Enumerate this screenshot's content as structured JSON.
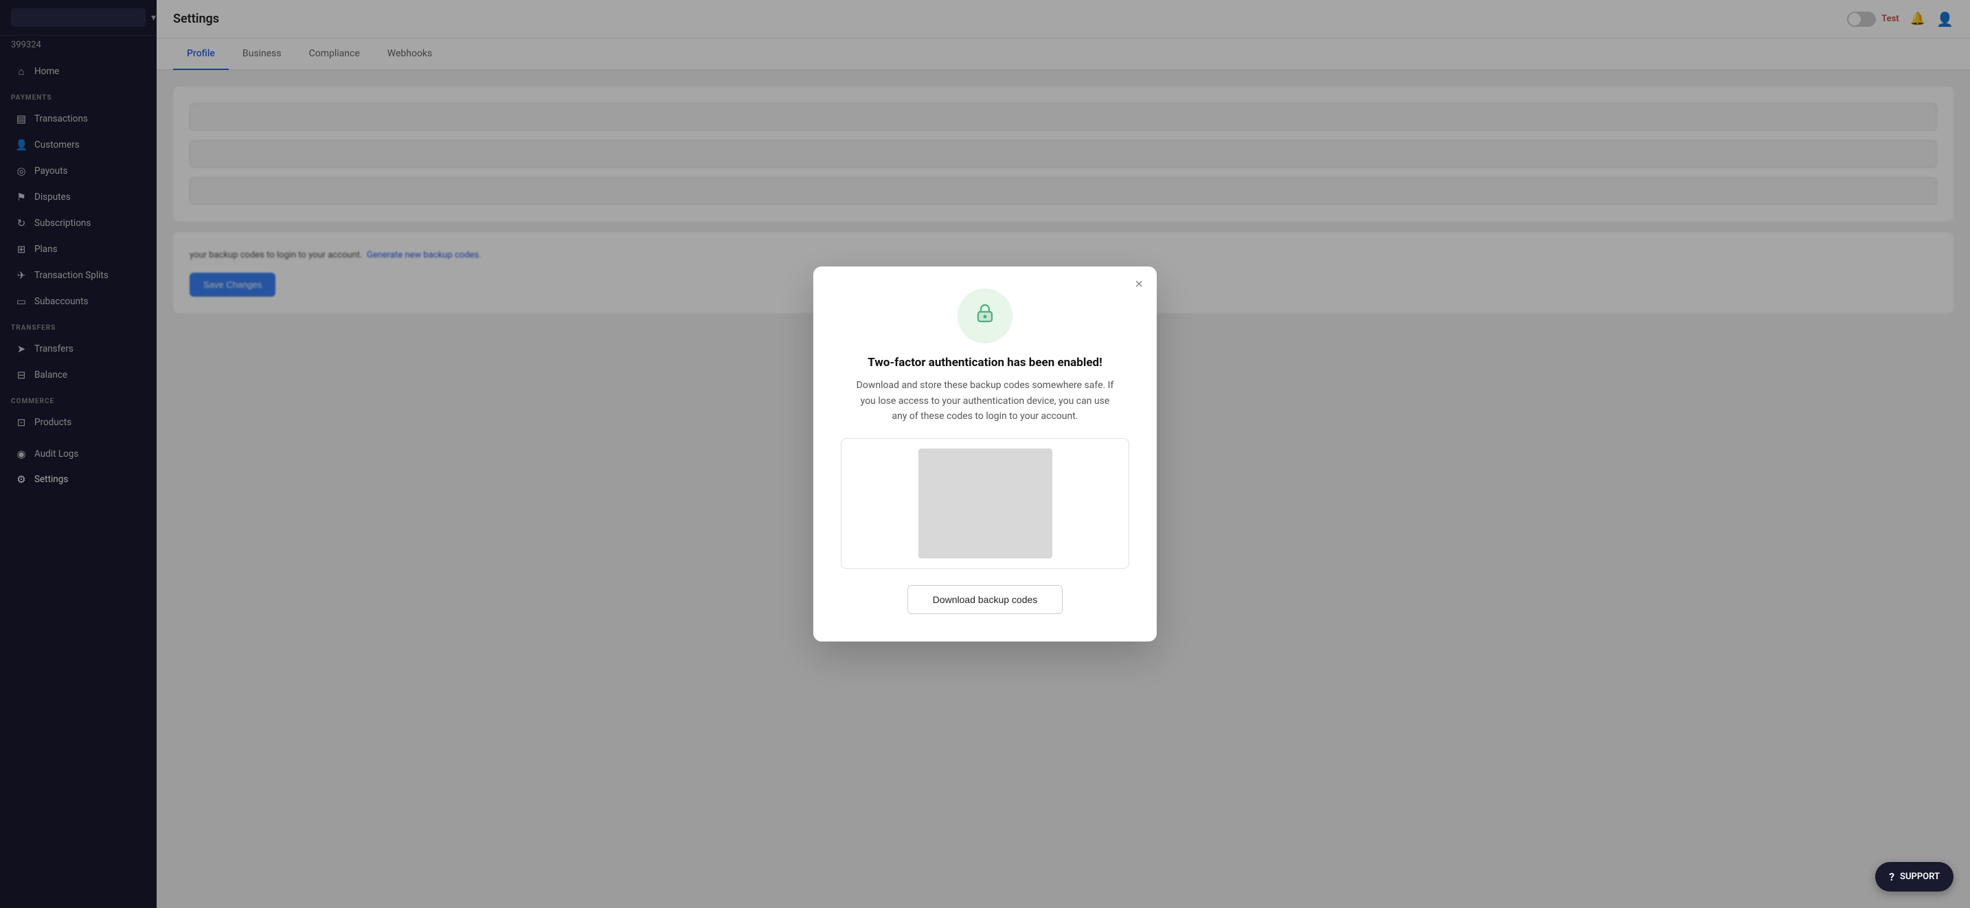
{
  "sidebar": {
    "search_placeholder": "",
    "account_id": "399324",
    "chevron": "▾",
    "sections": [
      {
        "label": "",
        "items": [
          {
            "id": "home",
            "label": "Home",
            "icon": "⌂"
          }
        ]
      },
      {
        "label": "PAYMENTS",
        "items": [
          {
            "id": "transactions",
            "label": "Transactions",
            "icon": "▤"
          },
          {
            "id": "customers",
            "label": "Customers",
            "icon": "👤"
          },
          {
            "id": "payouts",
            "label": "Payouts",
            "icon": "◎"
          },
          {
            "id": "disputes",
            "label": "Disputes",
            "icon": "⚑"
          },
          {
            "id": "subscriptions",
            "label": "Subscriptions",
            "icon": "↻"
          },
          {
            "id": "plans",
            "label": "Plans",
            "icon": "⊞"
          },
          {
            "id": "transaction-splits",
            "label": "Transaction Splits",
            "icon": "✈"
          },
          {
            "id": "subaccounts",
            "label": "Subaccounts",
            "icon": "▭"
          }
        ]
      },
      {
        "label": "TRANSFERS",
        "items": [
          {
            "id": "transfers",
            "label": "Transfers",
            "icon": "➤"
          },
          {
            "id": "balance",
            "label": "Balance",
            "icon": "⊟"
          }
        ]
      },
      {
        "label": "COMMERCE",
        "items": [
          {
            "id": "products",
            "label": "Products",
            "icon": "⊡"
          }
        ]
      },
      {
        "label": "",
        "items": [
          {
            "id": "audit-logs",
            "label": "Audit Logs",
            "icon": "◉"
          },
          {
            "id": "settings",
            "label": "Settings",
            "icon": "⚙"
          }
        ]
      }
    ]
  },
  "topbar": {
    "title": "Settings",
    "toggle_label": "Test",
    "bell_icon": "🔔",
    "user_icon": "👤"
  },
  "settings_tabs": {
    "tabs": [
      {
        "id": "profile",
        "label": "Profile",
        "active": true
      },
      {
        "id": "business",
        "label": "Business",
        "active": false
      },
      {
        "id": "compliance",
        "label": "Compliance",
        "active": false
      },
      {
        "id": "webhooks",
        "label": "Webhooks",
        "active": false
      }
    ]
  },
  "modal": {
    "close_label": "×",
    "icon": "🔒",
    "title": "Two-factor authentication has been enabled!",
    "description": "Download and store these backup codes somewhere safe. If you lose access to your authentication device, you can use any of these codes to login to your account.",
    "download_button_label": "Download backup codes"
  },
  "background": {
    "lower_text": "your backup codes to login to your account.",
    "generate_link": "Generate new backup codes."
  },
  "support": {
    "label": "SUPPORT",
    "icon": "?"
  }
}
